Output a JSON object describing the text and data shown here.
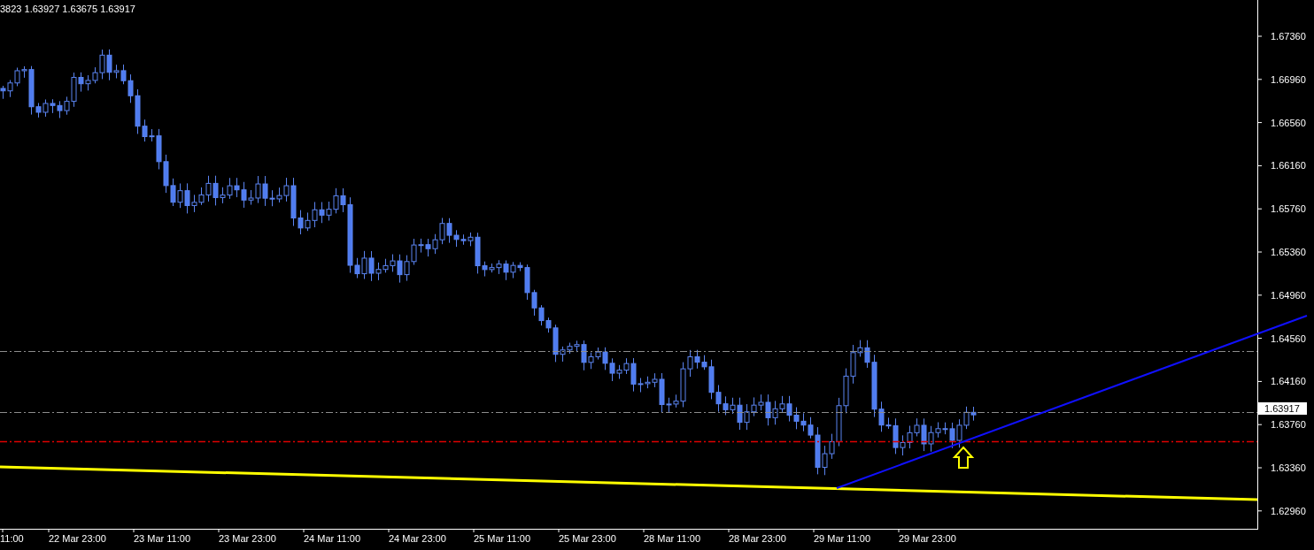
{
  "header": {
    "text": "3823 1.63927 1.63675 1.63917"
  },
  "price_axis": {
    "labels": [
      "1.67360",
      "1.66960",
      "1.66560",
      "1.66160",
      "1.65760",
      "1.65360",
      "1.64960",
      "1.64560",
      "1.64160",
      "1.63760",
      "1.63360",
      "1.62960"
    ]
  },
  "current_price": {
    "label": "1.63917"
  },
  "time_axis": {
    "labels": [
      "11:00",
      "22 Mar 23:00",
      "23 Mar 11:00",
      "23 Mar 23:00",
      "24 Mar 11:00",
      "24 Mar 23:00",
      "25 Mar 11:00",
      "25 Mar 23:00",
      "28 Mar 11:00",
      "28 Mar 23:00",
      "29 Mar 11:00",
      "29 Mar 23:00"
    ]
  }
}
